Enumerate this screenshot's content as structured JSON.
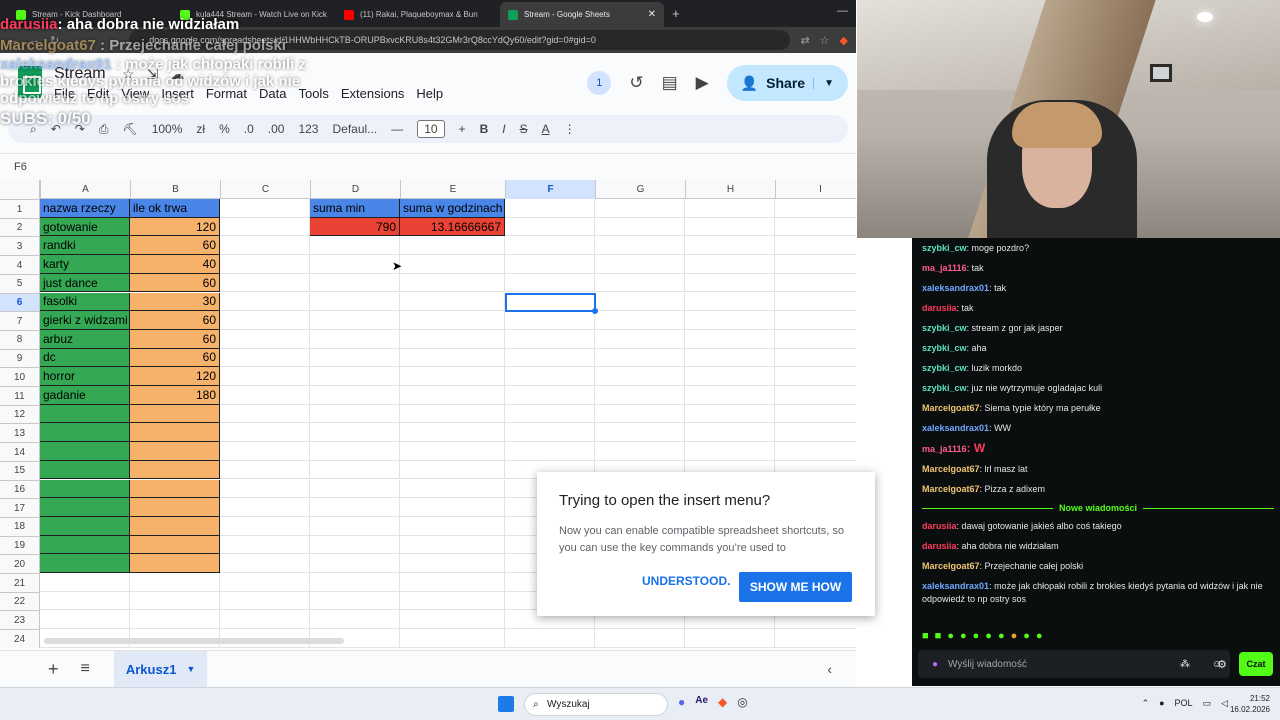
{
  "browser": {
    "tabs": [
      {
        "title": "Stream - Kick Dashboard",
        "color": "#53fc18"
      },
      {
        "title": "kula444 Stream - Watch Live on Kick",
        "color": "#53fc18"
      },
      {
        "title": "(11) Rakai, Plaqueboymax & Bun",
        "color": "#ff0000"
      },
      {
        "title": "Stream - Google Sheets",
        "color": "#0f9d58",
        "close": "✕"
      }
    ],
    "url": "docs.google.com/spreadsheets/d/1HHWbHHCkTB-ORUPBxvcKRU8s4t32GMr3rQ8ccYdQy60/edit?gid=0#gid=0"
  },
  "sheets": {
    "doc_title": "Stream",
    "menu": [
      "File",
      "Edit",
      "View",
      "Insert",
      "Format",
      "Data",
      "Tools",
      "Extensions",
      "Help"
    ],
    "viewers": "1",
    "share_label": "Share",
    "toolbar": {
      "zoom": "100%",
      "currency": "zł",
      "percent": "%",
      "dec_less": ".0",
      "dec_more": ".00",
      "num_format": "123",
      "font": "Defaul...",
      "font_size": "10"
    },
    "name_box": "F6",
    "col_headers": [
      "A",
      "B",
      "C",
      "D",
      "E",
      "F",
      "G",
      "H",
      "I"
    ],
    "row_headers": [
      "1",
      "2",
      "3",
      "4",
      "5",
      "6",
      "7",
      "8",
      "9",
      "10",
      "11",
      "12",
      "13",
      "14",
      "15",
      "16",
      "17",
      "18",
      "19",
      "20",
      "21",
      "22",
      "23",
      "24"
    ],
    "cells": {
      "header_a": "nazwa rzeczy",
      "header_b": "ile ok trwa",
      "header_d": "suma min",
      "header_e": "suma w godzinach",
      "sum_min": "790",
      "sum_hours": "13.16666667",
      "items": [
        {
          "name": "gotowanie",
          "minutes": "120"
        },
        {
          "name": "randki",
          "minutes": "60"
        },
        {
          "name": "karty",
          "minutes": "40"
        },
        {
          "name": "just dance",
          "minutes": "60"
        },
        {
          "name": "fasolki",
          "minutes": "30"
        },
        {
          "name": "gierki z widzami",
          "minutes": "60"
        },
        {
          "name": "arbuz",
          "minutes": "60"
        },
        {
          "name": "dc",
          "minutes": "60"
        },
        {
          "name": "horror",
          "minutes": "120"
        },
        {
          "name": "gadanie",
          "minutes": "180"
        }
      ]
    },
    "sheet_tab": "Arkusz1",
    "dialog": {
      "title": "Trying to open the insert menu?",
      "body": "Now you can enable compatible spreadsheet shortcuts, so you can use the key commands you’re used to",
      "understood": "UNDERSTOOD.",
      "show_me": "SHOW ME HOW"
    },
    "colors": {
      "green": "#34a853",
      "orange": "#f6b26b",
      "blue": "#4a86e8",
      "red": "#ea4335"
    }
  },
  "overlay": [
    {
      "user": "darusiia",
      "text": ": aha dobra nie widziałam",
      "color": "#ff3b5c"
    },
    {
      "user": "Marcelgoat67",
      "text": " : Przejechanie całej polski",
      "color": "#f0c674"
    },
    {
      "user": "xaleksandrax01",
      "text": " : może jak chłopaki robili z brokies kiedyś pytania od widzów i jak nie odpowiedź to np ostry sos",
      "color": "#6ea8ff"
    },
    {
      "user": "",
      "text": "SUBS: 0/50",
      "color": "#ffffff"
    }
  ],
  "chat": {
    "messages": [
      {
        "user": "szybki_cw",
        "text": ": moge pozdro?",
        "color": "#5ee2c0"
      },
      {
        "user": "ma_ja1116",
        "text": ": tak",
        "color": "#ff5c8a"
      },
      {
        "user": "xaleksandrax01",
        "text": ": tak",
        "color": "#6ea8ff"
      },
      {
        "user": "darusiia",
        "text": ": tak",
        "color": "#ff3b5c"
      },
      {
        "user": "szybki_cw",
        "text": ": stream z gor jak jasper",
        "color": "#5ee2c0"
      },
      {
        "user": "szybki_cw",
        "text": ": aha",
        "color": "#5ee2c0"
      },
      {
        "user": "szybki_cw",
        "text": ": luzik morkdo",
        "color": "#5ee2c0"
      },
      {
        "user": "szybki_cw",
        "text": ": juz nie wytrzymuje ogladajac kuli",
        "color": "#5ee2c0"
      },
      {
        "user": "Marcelgoat67",
        "text": ": Siema typie który ma perułke",
        "color": "#f0c674"
      },
      {
        "user": "xaleksandrax01",
        "text": ": WW",
        "color": "#6ea8ff"
      },
      {
        "user": "ma_ja1116",
        "text": ": W",
        "color": "#ff5c8a"
      },
      {
        "user": "Marcelgoat67",
        "text": ": lrl masz lat",
        "color": "#f0c674"
      },
      {
        "user": "Marcelgoat67",
        "text": ": Pizza z adixem",
        "color": "#f0c674"
      }
    ],
    "divider": "Nowe wiadomości",
    "new_messages": [
      {
        "user": "darusiia",
        "text": ": dawaj gotowanie jakieś albo coś takiego",
        "color": "#ff3b5c"
      },
      {
        "user": "darusiia",
        "text": ": aha dobra nie widziałam",
        "color": "#ff3b5c"
      },
      {
        "user": "Marcelgoat67",
        "text": ": Przejechanie całej polski",
        "color": "#f0c674"
      },
      {
        "user": "xaleksandrax01",
        "text": ": może jak chłopaki robili z brokies kiedyś pytania od widzów i jak nie odpowiedź to np ostry sos",
        "color": "#6ea8ff"
      }
    ],
    "input_placeholder": "Wyślij wiadomość",
    "send_label": "Czat"
  },
  "taskbar": {
    "search_label": "Wyszukaj",
    "lang": "POL",
    "time": "21:52",
    "date": "16.02.2026"
  }
}
